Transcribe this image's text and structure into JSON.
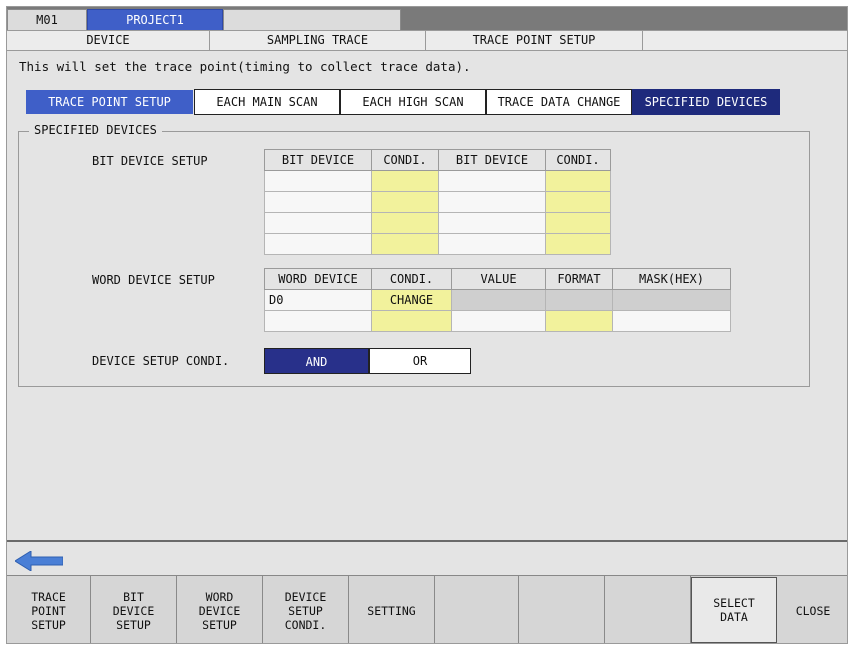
{
  "top_tabs": {
    "station": "M01",
    "project": "PROJECT1"
  },
  "sub_tabs": {
    "device": "DEVICE",
    "sampling_trace": "SAMPLING TRACE",
    "trace_point_setup": "TRACE POINT SETUP"
  },
  "description": "This will set the trace point(timing to collect trace data).",
  "mode": {
    "label": "TRACE POINT SETUP",
    "options": [
      "EACH MAIN SCAN",
      "EACH HIGH SCAN",
      "TRACE DATA CHANGE",
      "SPECIFIED DEVICES"
    ],
    "selected": "SPECIFIED DEVICES"
  },
  "group_title": "SPECIFIED DEVICES",
  "bit_setup": {
    "label": "BIT DEVICE SETUP",
    "headers": [
      "BIT DEVICE",
      "CONDI.",
      "BIT DEVICE",
      "CONDI."
    ],
    "rows": [
      [
        "",
        "",
        "",
        ""
      ],
      [
        "",
        "",
        "",
        ""
      ],
      [
        "",
        "",
        "",
        ""
      ],
      [
        "",
        "",
        "",
        ""
      ]
    ]
  },
  "word_setup": {
    "label": "WORD DEVICE SETUP",
    "headers": [
      "WORD DEVICE",
      "CONDI.",
      "VALUE",
      "FORMAT",
      "MASK(HEX)"
    ],
    "rows": [
      [
        "D0",
        "CHANGE",
        "",
        "",
        ""
      ],
      [
        "",
        "",
        "",
        "",
        ""
      ]
    ]
  },
  "device_condition": {
    "label": "DEVICE SETUP CONDI.",
    "and_label": "AND",
    "or_label": "OR",
    "selected": "AND"
  },
  "function_keys": [
    "TRACE\nPOINT\nSETUP",
    "BIT\nDEVICE\nSETUP",
    "WORD\nDEVICE\nSETUP",
    "DEVICE\nSETUP\nCONDI.",
    "SETTING",
    "",
    "",
    "",
    "SELECT\nDATA",
    "CLOSE"
  ],
  "colors": {
    "accent_blue": "#3f5fc8",
    "selected_navy": "#1e2a7c",
    "highlight_yellow": "#f2f29c",
    "back_arrow": "#4a7fd6"
  }
}
